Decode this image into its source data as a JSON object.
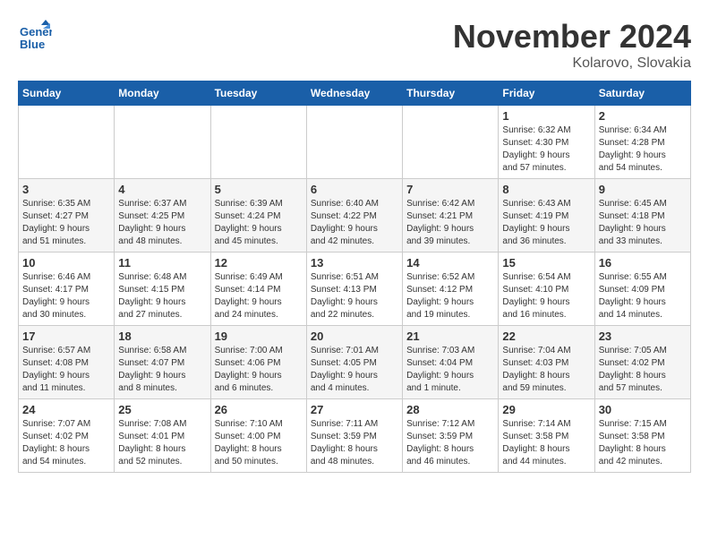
{
  "header": {
    "logo_line1": "General",
    "logo_line2": "Blue",
    "month_title": "November 2024",
    "location": "Kolarovo, Slovakia"
  },
  "weekdays": [
    "Sunday",
    "Monday",
    "Tuesday",
    "Wednesday",
    "Thursday",
    "Friday",
    "Saturday"
  ],
  "weeks": [
    [
      {
        "day": "",
        "info": ""
      },
      {
        "day": "",
        "info": ""
      },
      {
        "day": "",
        "info": ""
      },
      {
        "day": "",
        "info": ""
      },
      {
        "day": "",
        "info": ""
      },
      {
        "day": "1",
        "info": "Sunrise: 6:32 AM\nSunset: 4:30 PM\nDaylight: 9 hours\nand 57 minutes."
      },
      {
        "day": "2",
        "info": "Sunrise: 6:34 AM\nSunset: 4:28 PM\nDaylight: 9 hours\nand 54 minutes."
      }
    ],
    [
      {
        "day": "3",
        "info": "Sunrise: 6:35 AM\nSunset: 4:27 PM\nDaylight: 9 hours\nand 51 minutes."
      },
      {
        "day": "4",
        "info": "Sunrise: 6:37 AM\nSunset: 4:25 PM\nDaylight: 9 hours\nand 48 minutes."
      },
      {
        "day": "5",
        "info": "Sunrise: 6:39 AM\nSunset: 4:24 PM\nDaylight: 9 hours\nand 45 minutes."
      },
      {
        "day": "6",
        "info": "Sunrise: 6:40 AM\nSunset: 4:22 PM\nDaylight: 9 hours\nand 42 minutes."
      },
      {
        "day": "7",
        "info": "Sunrise: 6:42 AM\nSunset: 4:21 PM\nDaylight: 9 hours\nand 39 minutes."
      },
      {
        "day": "8",
        "info": "Sunrise: 6:43 AM\nSunset: 4:19 PM\nDaylight: 9 hours\nand 36 minutes."
      },
      {
        "day": "9",
        "info": "Sunrise: 6:45 AM\nSunset: 4:18 PM\nDaylight: 9 hours\nand 33 minutes."
      }
    ],
    [
      {
        "day": "10",
        "info": "Sunrise: 6:46 AM\nSunset: 4:17 PM\nDaylight: 9 hours\nand 30 minutes."
      },
      {
        "day": "11",
        "info": "Sunrise: 6:48 AM\nSunset: 4:15 PM\nDaylight: 9 hours\nand 27 minutes."
      },
      {
        "day": "12",
        "info": "Sunrise: 6:49 AM\nSunset: 4:14 PM\nDaylight: 9 hours\nand 24 minutes."
      },
      {
        "day": "13",
        "info": "Sunrise: 6:51 AM\nSunset: 4:13 PM\nDaylight: 9 hours\nand 22 minutes."
      },
      {
        "day": "14",
        "info": "Sunrise: 6:52 AM\nSunset: 4:12 PM\nDaylight: 9 hours\nand 19 minutes."
      },
      {
        "day": "15",
        "info": "Sunrise: 6:54 AM\nSunset: 4:10 PM\nDaylight: 9 hours\nand 16 minutes."
      },
      {
        "day": "16",
        "info": "Sunrise: 6:55 AM\nSunset: 4:09 PM\nDaylight: 9 hours\nand 14 minutes."
      }
    ],
    [
      {
        "day": "17",
        "info": "Sunrise: 6:57 AM\nSunset: 4:08 PM\nDaylight: 9 hours\nand 11 minutes."
      },
      {
        "day": "18",
        "info": "Sunrise: 6:58 AM\nSunset: 4:07 PM\nDaylight: 9 hours\nand 8 minutes."
      },
      {
        "day": "19",
        "info": "Sunrise: 7:00 AM\nSunset: 4:06 PM\nDaylight: 9 hours\nand 6 minutes."
      },
      {
        "day": "20",
        "info": "Sunrise: 7:01 AM\nSunset: 4:05 PM\nDaylight: 9 hours\nand 4 minutes."
      },
      {
        "day": "21",
        "info": "Sunrise: 7:03 AM\nSunset: 4:04 PM\nDaylight: 9 hours\nand 1 minute."
      },
      {
        "day": "22",
        "info": "Sunrise: 7:04 AM\nSunset: 4:03 PM\nDaylight: 8 hours\nand 59 minutes."
      },
      {
        "day": "23",
        "info": "Sunrise: 7:05 AM\nSunset: 4:02 PM\nDaylight: 8 hours\nand 57 minutes."
      }
    ],
    [
      {
        "day": "24",
        "info": "Sunrise: 7:07 AM\nSunset: 4:02 PM\nDaylight: 8 hours\nand 54 minutes."
      },
      {
        "day": "25",
        "info": "Sunrise: 7:08 AM\nSunset: 4:01 PM\nDaylight: 8 hours\nand 52 minutes."
      },
      {
        "day": "26",
        "info": "Sunrise: 7:10 AM\nSunset: 4:00 PM\nDaylight: 8 hours\nand 50 minutes."
      },
      {
        "day": "27",
        "info": "Sunrise: 7:11 AM\nSunset: 3:59 PM\nDaylight: 8 hours\nand 48 minutes."
      },
      {
        "day": "28",
        "info": "Sunrise: 7:12 AM\nSunset: 3:59 PM\nDaylight: 8 hours\nand 46 minutes."
      },
      {
        "day": "29",
        "info": "Sunrise: 7:14 AM\nSunset: 3:58 PM\nDaylight: 8 hours\nand 44 minutes."
      },
      {
        "day": "30",
        "info": "Sunrise: 7:15 AM\nSunset: 3:58 PM\nDaylight: 8 hours\nand 42 minutes."
      }
    ]
  ]
}
